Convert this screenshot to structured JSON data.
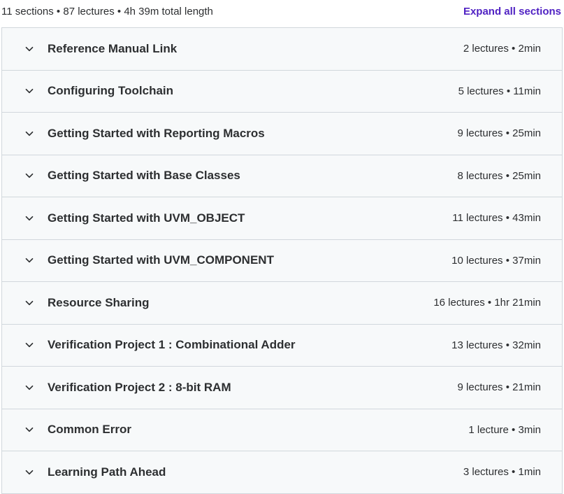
{
  "summary": {
    "text": "11 sections • 87 lectures • 4h 39m total length",
    "expand_label": "Expand all sections"
  },
  "colors": {
    "accent": "#5022c3",
    "row_background": "#f7f9fa",
    "border": "#d1d7dc",
    "text": "#2d2f31"
  },
  "sections": [
    {
      "title": "Reference Manual Link",
      "meta": "2 lectures • 2min",
      "icon": "chevron-down-icon"
    },
    {
      "title": "Configuring Toolchain",
      "meta": "5 lectures • 11min",
      "icon": "chevron-down-icon"
    },
    {
      "title": "Getting Started with Reporting Macros",
      "meta": "9 lectures • 25min",
      "icon": "chevron-down-icon"
    },
    {
      "title": "Getting Started with Base Classes",
      "meta": "8 lectures • 25min",
      "icon": "chevron-down-icon"
    },
    {
      "title": "Getting Started with UVM_OBJECT",
      "meta": "11 lectures • 43min",
      "icon": "chevron-down-icon"
    },
    {
      "title": "Getting Started with UVM_COMPONENT",
      "meta": "10 lectures • 37min",
      "icon": "chevron-down-icon"
    },
    {
      "title": "Resource Sharing",
      "meta": "16 lectures • 1hr 21min",
      "icon": "chevron-down-icon"
    },
    {
      "title": "Verification Project 1 : Combinational Adder",
      "meta": "13 lectures • 32min",
      "icon": "chevron-down-icon"
    },
    {
      "title": "Verification Project 2 : 8-bit RAM",
      "meta": "9 lectures • 21min",
      "icon": "chevron-down-icon"
    },
    {
      "title": "Common Error",
      "meta": "1 lecture • 3min",
      "icon": "chevron-down-icon"
    },
    {
      "title": "Learning Path Ahead",
      "meta": "3 lectures • 1min",
      "icon": "chevron-down-icon"
    }
  ]
}
